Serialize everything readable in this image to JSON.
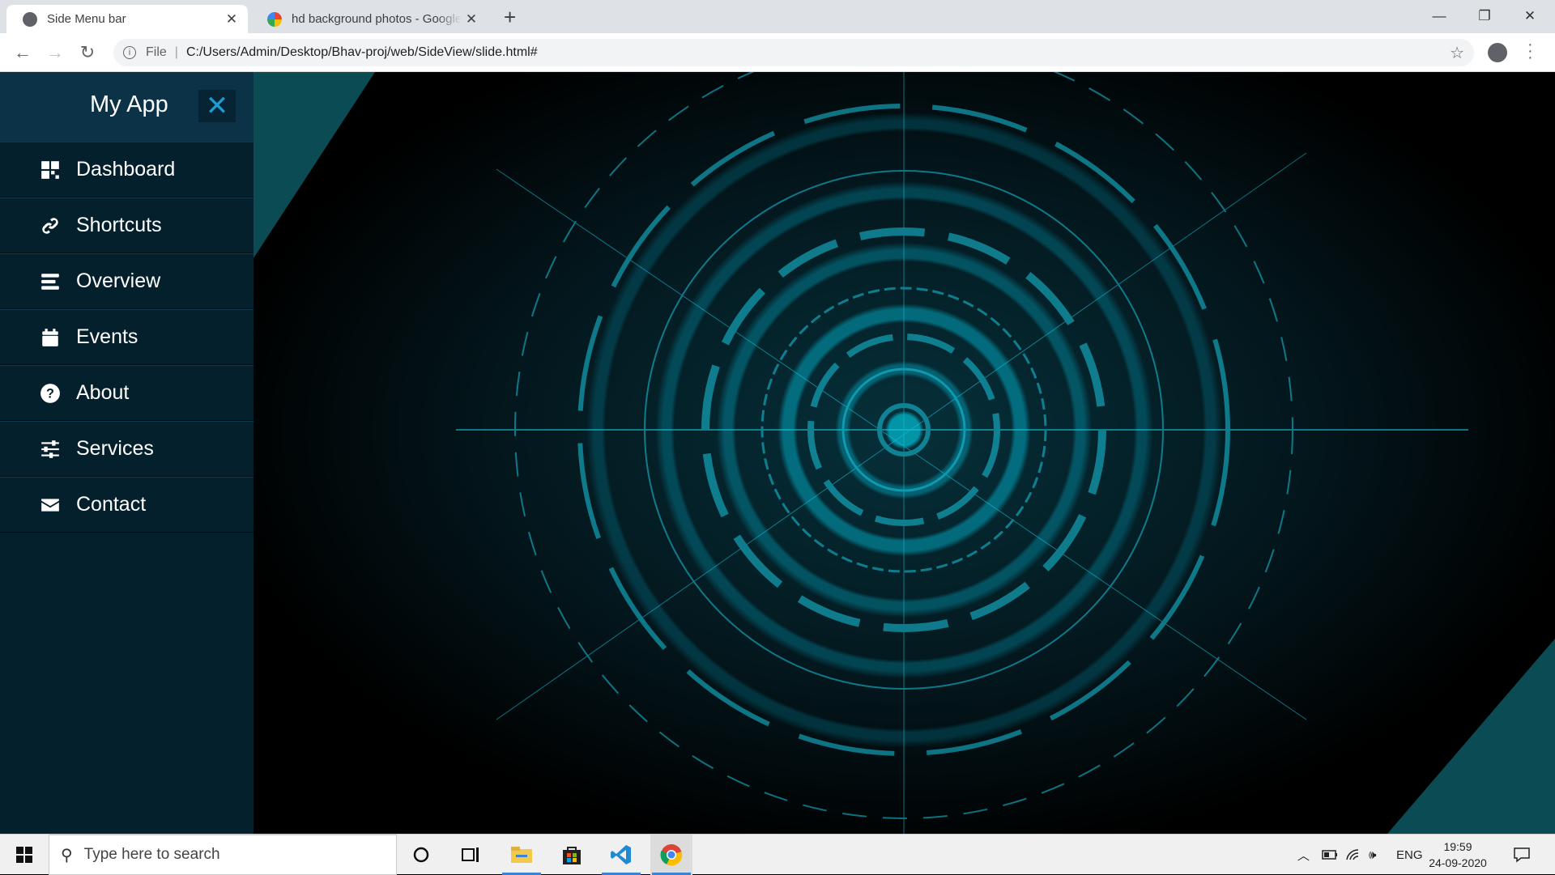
{
  "browser": {
    "tabs": [
      {
        "title": "Side Menu bar",
        "active": true
      },
      {
        "title": "hd background photos - Google Search",
        "active": false
      }
    ],
    "file_label": "File",
    "url": "C:/Users/Admin/Desktop/Bhav-proj/web/SideView/slide.html#"
  },
  "sidebar": {
    "app_title": "My App",
    "items": [
      {
        "label": "Dashboard",
        "icon": "dashboard-icon"
      },
      {
        "label": "Shortcuts",
        "icon": "link-icon"
      },
      {
        "label": "Overview",
        "icon": "stream-icon"
      },
      {
        "label": "Events",
        "icon": "calendar-icon"
      },
      {
        "label": "About",
        "icon": "question-circle-icon"
      },
      {
        "label": "Services",
        "icon": "sliders-icon"
      },
      {
        "label": "Contact",
        "icon": "envelope-icon"
      }
    ]
  },
  "taskbar": {
    "search_placeholder": "Type here to search",
    "language": "ENG",
    "time": "19:59",
    "date": "24-09-2020"
  },
  "colors": {
    "sidebar_bg": "#05202d",
    "sidebar_header_bg": "#0b3247",
    "close_icon": "#1e9bd0",
    "accent_cyan": "#00d8f0"
  }
}
